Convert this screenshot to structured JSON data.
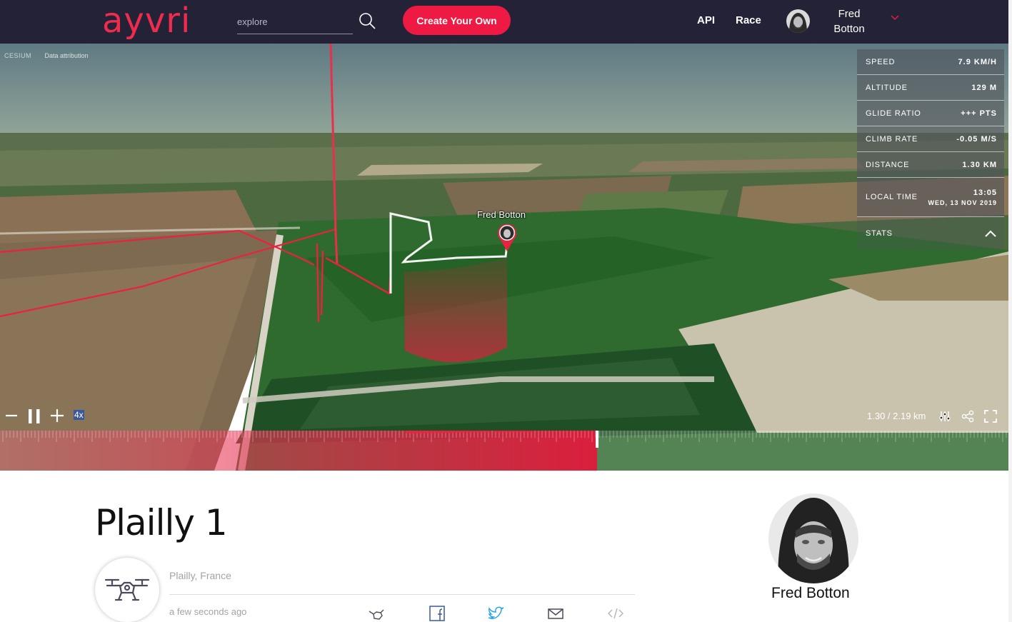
{
  "nav": {
    "logo": "ayvri",
    "search_placeholder": "explore",
    "create_label": "Create Your Own",
    "api_label": "API",
    "race_label": "Race",
    "user_first": "Fred",
    "user_last": "Botton"
  },
  "map": {
    "attribution_brand": "CESIUM",
    "attribution_text": "Data attribution",
    "pilot_label": "Fred Botton"
  },
  "stats": {
    "rows": [
      {
        "label": "SPEED",
        "value": "7.9 KM/H"
      },
      {
        "label": "ALTITUDE",
        "value": "129 M"
      },
      {
        "label": "GLIDE RATIO",
        "value": "+++ PTS"
      },
      {
        "label": "CLIMB RATE",
        "value": "-0.05 M/S"
      },
      {
        "label": "DISTANCE",
        "value": "1.30 KM"
      }
    ],
    "local_time_label": "LOCAL TIME",
    "local_time": "13:05",
    "local_date": "WED, 13 NOV 2019",
    "toggle_label": "STATS"
  },
  "timeline": {
    "progress_fraction": 0.59,
    "speed": "4x",
    "distance_readout": "1.30 / 2.19 km"
  },
  "flight": {
    "title": "Plailly 1",
    "location": "Plailly, France",
    "time_ago": "a few seconds ago",
    "pilot_name": "Fred Botton"
  },
  "colors": {
    "brand": "#ef1a44",
    "nav_bg": "#232237",
    "track": "#e8223f"
  }
}
